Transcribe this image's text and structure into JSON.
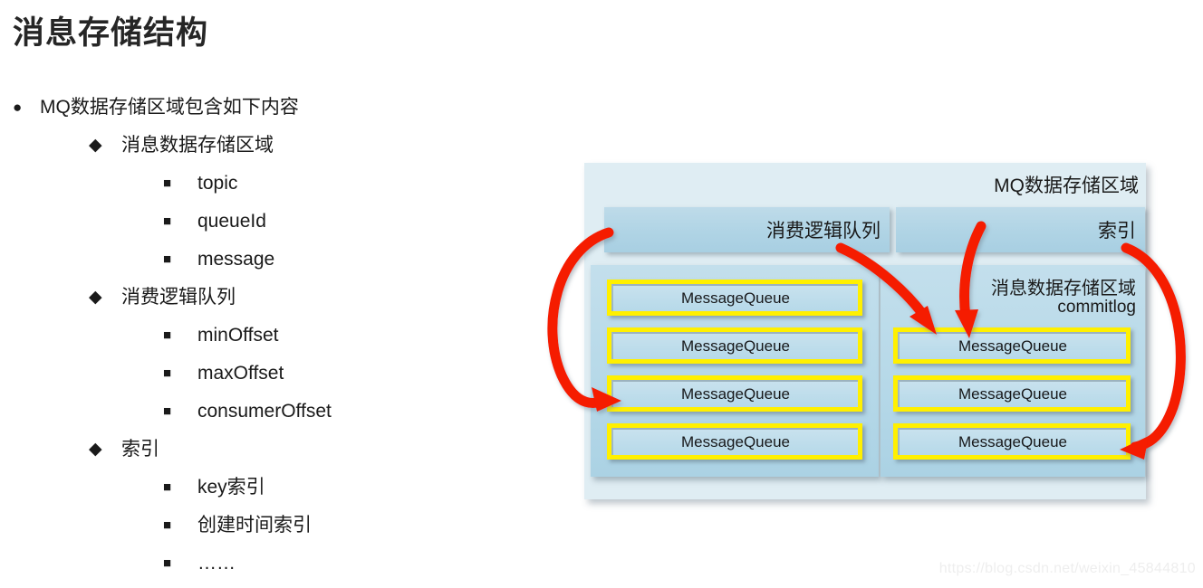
{
  "slide": {
    "title": "消息存储结构",
    "watermark": "https://blog.csdn.net/weixin_45844810"
  },
  "outline": [
    {
      "level": 1,
      "bullet": "●",
      "label": "MQ数据存储区域包含如下内容"
    },
    {
      "level": 2,
      "bullet": "◆",
      "label": "消息数据存储区域"
    },
    {
      "level": 3,
      "bullet": "■",
      "label": "topic"
    },
    {
      "level": 3,
      "bullet": "■",
      "label": "queueId"
    },
    {
      "level": 3,
      "bullet": "■",
      "label": "message"
    },
    {
      "level": 2,
      "bullet": "◆",
      "label": "消费逻辑队列"
    },
    {
      "level": 3,
      "bullet": "■",
      "label": "minOffset"
    },
    {
      "level": 3,
      "bullet": "■",
      "label": "maxOffset"
    },
    {
      "level": 3,
      "bullet": "■",
      "label": "consumerOffset"
    },
    {
      "level": 2,
      "bullet": "◆",
      "label": "索引"
    },
    {
      "level": 3,
      "bullet": "■",
      "label": "key索引"
    },
    {
      "level": 3,
      "bullet": "■",
      "label": "创建时间索引"
    },
    {
      "level": 3,
      "bullet": "■",
      "label": "……"
    }
  ],
  "diagram": {
    "container_title": "MQ数据存储区域",
    "headers": [
      {
        "id": "consume-queue",
        "label": "消费逻辑队列"
      },
      {
        "id": "index",
        "label": "索引"
      }
    ],
    "panels": [
      {
        "id": "consume-queue-panel",
        "captions": [],
        "boxes": [
          {
            "label": "MessageQueue"
          },
          {
            "label": "MessageQueue"
          },
          {
            "label": "MessageQueue"
          },
          {
            "label": "MessageQueue"
          }
        ]
      },
      {
        "id": "commitlog-panel",
        "captions": [
          "消息数据存储区域",
          "commitlog"
        ],
        "boxes": [
          {
            "label": "MessageQueue"
          },
          {
            "label": "MessageQueue"
          },
          {
            "label": "MessageQueue"
          }
        ]
      }
    ],
    "colors": {
      "arrow": "#f51a04",
      "box_border": "#fff000",
      "panel_fill": "#b5d8e8",
      "container_fill": "#dfedf3",
      "header_fill": "#b0d4e5"
    }
  }
}
